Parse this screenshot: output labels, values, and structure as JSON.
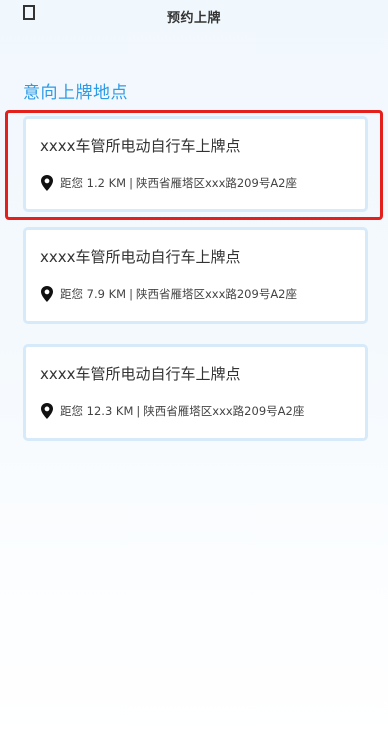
{
  "header": {
    "title": "预约上牌"
  },
  "section": {
    "title": "意向上牌地点"
  },
  "locations": [
    {
      "name": "xxxx车管所电动自行车上牌点",
      "distance": "距您 1.2 KM",
      "separator": "|",
      "address": "陕西省雁塔区xxx路209号A2座"
    },
    {
      "name": "xxxx车管所电动自行车上牌点",
      "distance": "距您 7.9 KM",
      "separator": "|",
      "address": "陕西省雁塔区xxx路209号A2座"
    },
    {
      "name": "xxxx车管所电动自行车上牌点",
      "distance": "距您 12.3 KM",
      "separator": "|",
      "address": "陕西省雁塔区xxx路209号A2座"
    }
  ],
  "icons": {
    "back": "back-icon",
    "location": "location-pin-icon"
  },
  "colors": {
    "accent": "#2d9be6",
    "selection": "#e3201b",
    "card_border": "#d7eaf9"
  }
}
